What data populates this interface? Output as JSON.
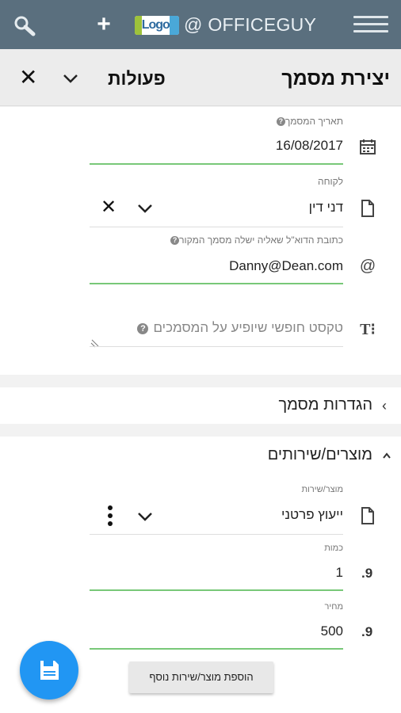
{
  "topbar": {
    "brand": "@ OFFICEGUY",
    "logo_text": "Logo",
    "icons": {
      "search": "search-icon",
      "add": "plus-icon",
      "menu": "hamburger-menu-icon"
    }
  },
  "header": {
    "title": "יצירת מסמך",
    "actions_label": "פעולות",
    "close": "✕"
  },
  "form": {
    "doc_date": {
      "label": "תאריך המסמך",
      "value": "16/08/2017",
      "icon": "calendar-icon"
    },
    "customer": {
      "label": "לקוחה",
      "value": "דני דין",
      "icon": "document-icon"
    },
    "email": {
      "label": "כתובת הדוא\"ל שאליה ישלה מסמך המקור",
      "value": "Danny@Dean.com",
      "icon": "at-icon"
    },
    "free_text": {
      "placeholder": "טקסט חופשי שיופיע על המסמכים",
      "icon": "text-icon"
    }
  },
  "sections": {
    "doc_settings": "הגדרות מסמך",
    "products": "מוצרים/שירותים"
  },
  "product": {
    "item": {
      "label": "מוצר/שירות",
      "value": "ייעוץ פרטני"
    },
    "quantity": {
      "label": "כמות",
      "value": "1"
    },
    "price": {
      "label": "מחיר",
      "value": "500"
    },
    "prefix_glyph": ".9"
  },
  "buttons": {
    "add_product": "הוספת מוצר/שירות נוסף",
    "save_icon": "save-icon"
  },
  "colors": {
    "topbar": "#5a6f7e",
    "accent_green": "#78c878",
    "fab_blue": "#2196f3"
  }
}
